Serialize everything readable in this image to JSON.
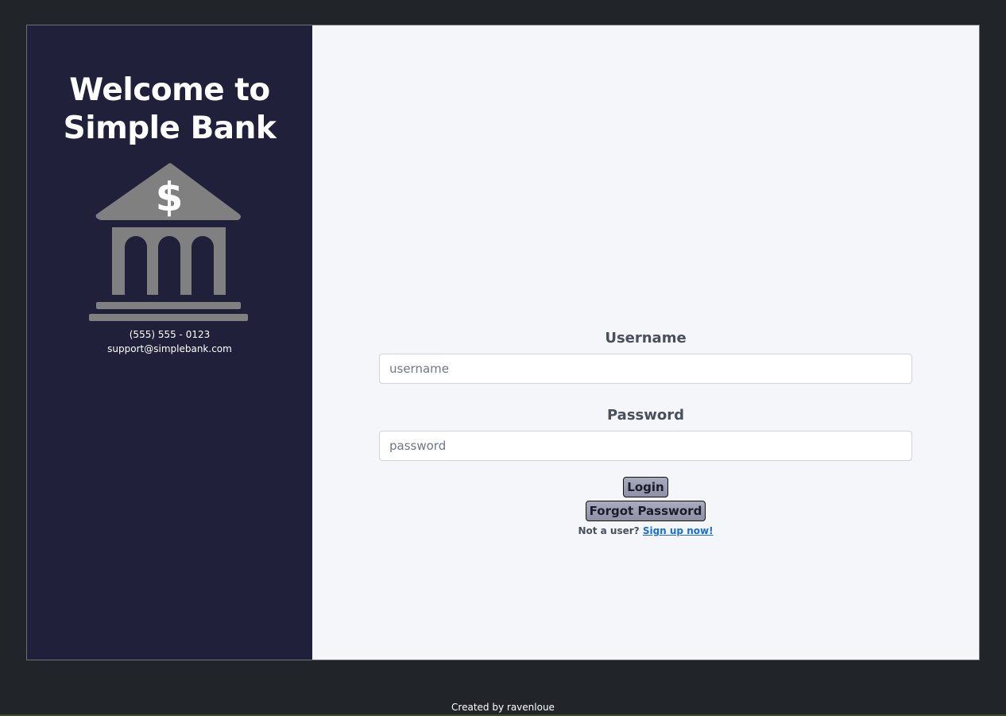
{
  "left_panel": {
    "title": "Welcome to Simple Bank",
    "logo_icon": "bank-dollar-icon",
    "phone": "(555) 555 - 0123",
    "email": "support@simplebank.com"
  },
  "login_form": {
    "username_label": "Username",
    "username_placeholder": "username",
    "password_label": "Password",
    "password_placeholder": "password",
    "login_button": "Login",
    "forgot_button": "Forgot Password",
    "signup_prompt": "Not a user?",
    "signup_link": "Sign up now!"
  },
  "footer": {
    "credit": "Created by ravenloue"
  },
  "colors": {
    "page_background": "#212529",
    "left_panel": "#20203a",
    "right_panel": "#f5f6fa",
    "logo": "#808080",
    "link": "#1a6fd6"
  }
}
